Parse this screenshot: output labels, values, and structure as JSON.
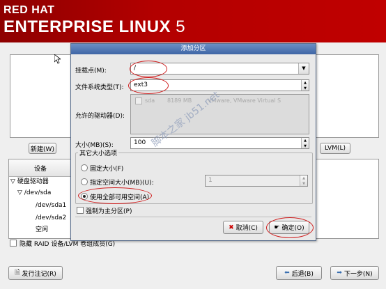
{
  "header": {
    "line1": "RED HAT",
    "line2": "ENTERPRISE LINUX",
    "version": "5"
  },
  "main": {
    "new_button": "新建(W)",
    "lvm_button": "LVM(L)",
    "device_header": "设备",
    "tree": [
      "硬盘驱动器",
      "/dev/sda",
      "/dev/sda1",
      "/dev/sda2",
      "空闲"
    ],
    "hide_raid": "隐藏 RAID 设备/LVM 卷组成员(G)"
  },
  "dialog": {
    "title": "添加分区",
    "mount_label": "挂载点(M):",
    "mount_value": "/",
    "fs_label": "文件系统类型(T):",
    "fs_value": "ext3",
    "drives_label": "允许的驱动器(D):",
    "drive": {
      "name": "sda",
      "size": "8189 MB",
      "model": "VMware, VMware Virtual S"
    },
    "size_label": "大小(MB)(S):",
    "size_value": "100",
    "options_title": "其它大小选项",
    "opt_fixed": "固定大小(F)",
    "opt_upto": "指定空间大小(MB)(U):",
    "opt_upto_value": "1",
    "opt_fill": "使用全部可用空间(A)",
    "force_primary": "强制为主分区(P)",
    "cancel_button": "取消(C)",
    "ok_button": "确定(O)"
  },
  "footer": {
    "release_notes": "发行注记(R)",
    "back": "后退(B)",
    "next": "下一步(N)"
  },
  "watermark": "脚本之家 jb51.net",
  "colors": {
    "header_red": "#b30000",
    "title_blue": "#3f66a6",
    "annotation_red": "#d02020"
  }
}
